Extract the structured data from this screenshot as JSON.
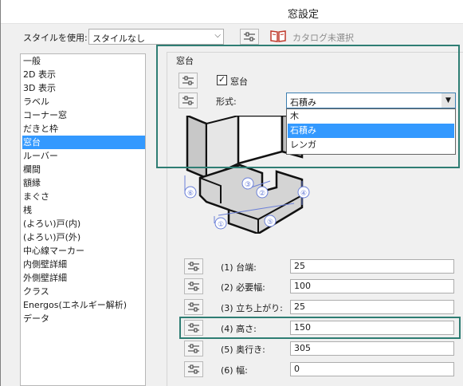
{
  "window": {
    "title": "窓設定"
  },
  "toolbar": {
    "style_label": "スタイルを使用:",
    "style_value": "スタイルなし",
    "catalog_label": "カタログ未選択"
  },
  "sidebar": {
    "items": [
      {
        "label": "一般"
      },
      {
        "label": "2D 表示"
      },
      {
        "label": "3D 表示"
      },
      {
        "label": "ラベル"
      },
      {
        "label": "コーナー窓"
      },
      {
        "label": "だきと枠"
      },
      {
        "label": "窓台"
      },
      {
        "label": "ルーバー"
      },
      {
        "label": "欄間"
      },
      {
        "label": "額縁"
      },
      {
        "label": "まぐさ"
      },
      {
        "label": "桟"
      },
      {
        "label": "(よろい)戸(内)"
      },
      {
        "label": "(よろい)戸(外)"
      },
      {
        "label": "中心線マーカー"
      },
      {
        "label": "内側壁詳細"
      },
      {
        "label": "外側壁詳細"
      },
      {
        "label": "クラス"
      },
      {
        "label": "Energos(エネルギー解析)"
      },
      {
        "label": "データ"
      }
    ],
    "selected": "窓台"
  },
  "panel": {
    "group_label": "窓台",
    "sill_checkbox_label": "窓台",
    "sill_checked": true,
    "form_label": "形式:",
    "form_value": "石積み",
    "form_options": [
      "木",
      "石積み",
      "レンガ"
    ],
    "form_options_selected": "石積み"
  },
  "illustration": {
    "callouts": [
      "①",
      "②",
      "③",
      "④",
      "⑤",
      "⑥"
    ]
  },
  "params": [
    {
      "label": "(1) 台端:",
      "value": "25"
    },
    {
      "label": "(2) 必要幅:",
      "value": "100"
    },
    {
      "label": "(3) 立ち上がり:",
      "value": "25"
    },
    {
      "label": "(4) 高さ:",
      "value": "150"
    },
    {
      "label": "(5) 奥行き:",
      "value": "305"
    },
    {
      "label": "(6) 幅:",
      "value": "0"
    }
  ],
  "colors": {
    "selection": "#3399ff",
    "highlight": "#2e7d73",
    "callout": "#6a7fd8"
  }
}
